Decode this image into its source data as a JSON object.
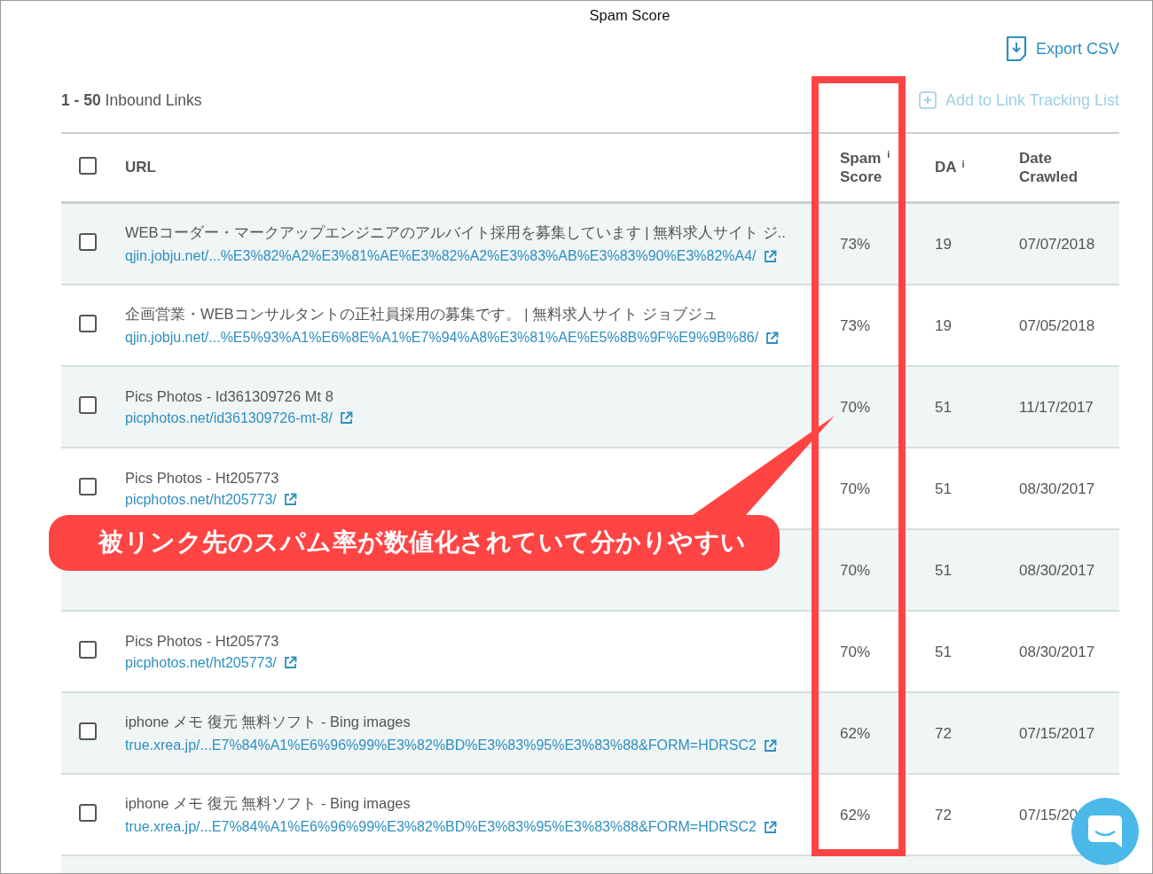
{
  "page_title": "Spam Score",
  "export_button": {
    "label": "Export CSV"
  },
  "result_count": {
    "range": "1 - 50",
    "label": "Inbound Links"
  },
  "add_button": {
    "label": "Add to Link Tracking List",
    "disabled": true
  },
  "table": {
    "select_all": {
      "checked": false
    },
    "columns": [
      {
        "label": "URL"
      },
      {
        "label": "Spam Score",
        "info": "i"
      },
      {
        "label": "DA",
        "info": "i"
      },
      {
        "label": "Date Crawled"
      }
    ],
    "rows": [
      {
        "title": "WEBコーダー・マークアップエンジニアのアルバイト採用を募集しています | 無料求人サイト ジ..",
        "url": "qjin.jobju.net/...%E3%82%A2%E3%81%AE%E3%82%A2%E3%83%AB%E3%83%90%E3%82%A4/",
        "spam_score": "73%",
        "da": "19",
        "date": "07/07/2018",
        "checked": false
      },
      {
        "title": "企画営業・WEBコンサルタントの正社員採用の募集です。 | 無料求人サイト ジョブジュ",
        "url": "qjin.jobju.net/...%E5%93%A1%E6%8E%A1%E7%94%A8%E3%81%AE%E5%8B%9F%E9%9B%86/",
        "spam_score": "73%",
        "da": "19",
        "date": "07/05/2018",
        "checked": false
      },
      {
        "title": "Pics Photos - Id361309726 Mt 8",
        "url": "picphotos.net/id361309726-mt-8/",
        "spam_score": "70%",
        "da": "51",
        "date": "11/17/2017",
        "checked": false
      },
      {
        "title": "Pics Photos - Ht205773",
        "url": "picphotos.net/ht205773/",
        "spam_score": "70%",
        "da": "51",
        "date": "08/30/2017",
        "checked": false
      },
      {
        "spam_score": "70%",
        "da": "51",
        "date": "08/30/2017"
      },
      {
        "title": "Pics Photos - Ht205773",
        "url": "picphotos.net/ht205773/",
        "spam_score": "70%",
        "da": "51",
        "date": "08/30/2017",
        "checked": false
      },
      {
        "title": "iphone メモ 復元 無料ソフト - Bing images",
        "url": "true.xrea.jp/...E7%84%A1%E6%96%99%E3%82%BD%E3%83%95%E3%83%88&FORM=HDRSC2",
        "spam_score": "62%",
        "da": "72",
        "date": "07/15/2017",
        "checked": false
      },
      {
        "title": "iphone メモ 復元 無料ソフト - Bing images",
        "url": "true.xrea.jp/...E7%84%A1%E6%96%99%E3%82%BD%E3%83%95%E3%83%88&FORM=HDRSC2",
        "spam_score": "62%",
        "da": "72",
        "date": "07/15/20",
        "checked": false
      }
    ]
  },
  "annotation": {
    "text": "被リンク先のスパム率が数値化されていて分かりやすい"
  }
}
